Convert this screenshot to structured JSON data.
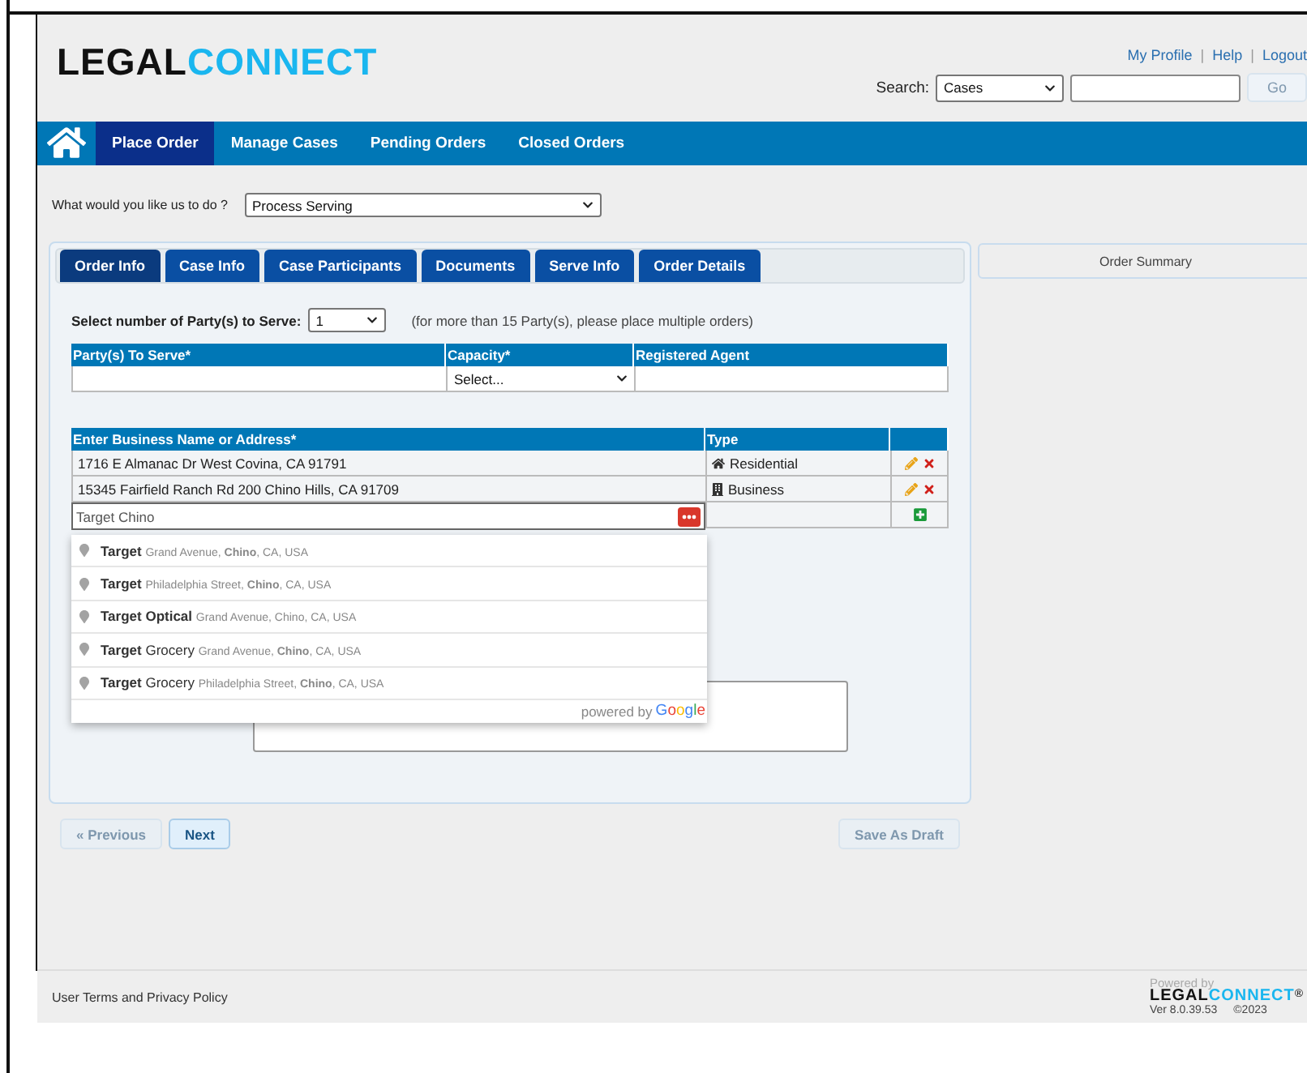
{
  "header": {
    "logo": [
      "LEGAL",
      "CONNECT"
    ],
    "links": [
      "My Profile",
      "Help",
      "Logout"
    ],
    "separator": "|",
    "search_label": "Search:",
    "search_select": "Cases",
    "go": {
      "label": "Go",
      "disabled": true
    }
  },
  "nav": [
    {
      "label": "Place Order",
      "selected": true
    },
    {
      "label": "Manage Cases",
      "selected": false
    },
    {
      "label": "Pending Orders",
      "selected": false
    },
    {
      "label": "Closed Orders",
      "selected": false
    }
  ],
  "task": {
    "label": "What would you like us to do ?",
    "value": "Process Serving"
  },
  "tabs": [
    {
      "label": "Order Info",
      "selected": true
    },
    {
      "label": "Case Info",
      "selected": false
    },
    {
      "label": "Case Participants",
      "selected": false
    },
    {
      "label": "Documents",
      "selected": false
    },
    {
      "label": "Serve Info",
      "selected": false
    },
    {
      "label": "Order Details",
      "selected": false
    }
  ],
  "party_count": {
    "label": "Select number of Party(s) to Serve:",
    "value": "1",
    "note": "(for more than 15 Party(s), please place multiple orders)"
  },
  "party_table": {
    "columns": [
      "Party(s) To Serve*",
      "Capacity*",
      "Registered Agent"
    ],
    "capacity_value": "Select..."
  },
  "address_table": {
    "columns": [
      "Enter Business Name or Address*",
      "Type"
    ],
    "rows": [
      {
        "address": "1716 E Almanac Dr West Covina, CA 91791",
        "type": "Residential",
        "kind": "residential"
      },
      {
        "address": "15345 Fairfield Ranch Rd 200 Chino Hills, CA 91709",
        "type": "Business",
        "kind": "business"
      }
    ],
    "input_value": "Target Chino"
  },
  "suggestions": [
    {
      "main": "**Target**",
      "secondary": "Grand Avenue, **Chino**, CA, USA"
    },
    {
      "main": "**Target**",
      "secondary": "Philadelphia Street, **Chino**, CA, USA"
    },
    {
      "main": "**Target Optical**",
      "secondary": "Grand Avenue, Chino, CA, USA"
    },
    {
      "main": "**Target** Grocery",
      "secondary": "Grand Avenue, **Chino**, CA, USA"
    },
    {
      "main": "**Target** Grocery",
      "secondary": "Philadelphia Street, **Chino**, CA, USA"
    }
  ],
  "powered_by": "powered by",
  "google": "Google",
  "buttons": {
    "previous": {
      "label": "« Previous",
      "disabled": true
    },
    "next": {
      "label": "Next",
      "disabled": false
    },
    "save": {
      "label": "Save As Draft",
      "disabled": true
    }
  },
  "order_summary": "Order Summary",
  "footer": {
    "link": "User Terms and Privacy Policy",
    "powered": "Powered by",
    "logo": [
      "LEGAL",
      "CONNECT"
    ],
    "reg": "®",
    "version": "Ver 8.0.39.53",
    "copyright": "©2023"
  }
}
